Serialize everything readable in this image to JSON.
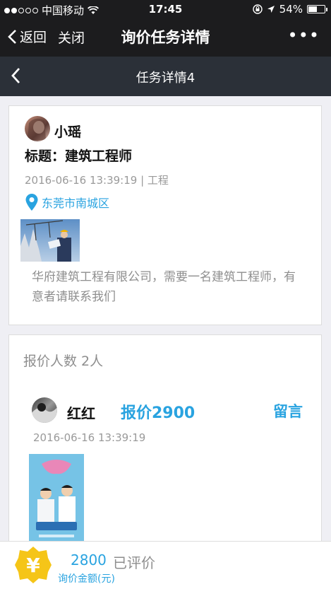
{
  "status_bar": {
    "carrier": "中国移动",
    "time": "17:45",
    "battery": "54%",
    "battery_level": 0.54
  },
  "nav": {
    "back_label": "返回",
    "close_label": "关闭",
    "title": "询价任务详情",
    "more_label": "•••"
  },
  "app_header": {
    "title": "任务详情4"
  },
  "task": {
    "username": "小瑶",
    "title": "标题：建筑工程师",
    "meta": "2016-06-16 13:39:19 | 工程",
    "location": "东莞市南城区",
    "description": "华府建筑工程有限公司，需要一名建筑工程师，有意者请联系我们"
  },
  "bids": {
    "count_label": "报价人数 2人",
    "items": [
      {
        "name": "红红",
        "price": "报价2900",
        "message_label": "留言",
        "time": "2016-06-16 13:39:19"
      }
    ]
  },
  "bottom_bar": {
    "amount": "2800",
    "status": "已评价",
    "caption": "询价金额(元)",
    "coin_symbol": "¥"
  },
  "colors": {
    "accent": "#29a3e0",
    "nav_bg": "#1c1c1e",
    "header_bg": "#2b3038",
    "coin": "#f5c518"
  }
}
